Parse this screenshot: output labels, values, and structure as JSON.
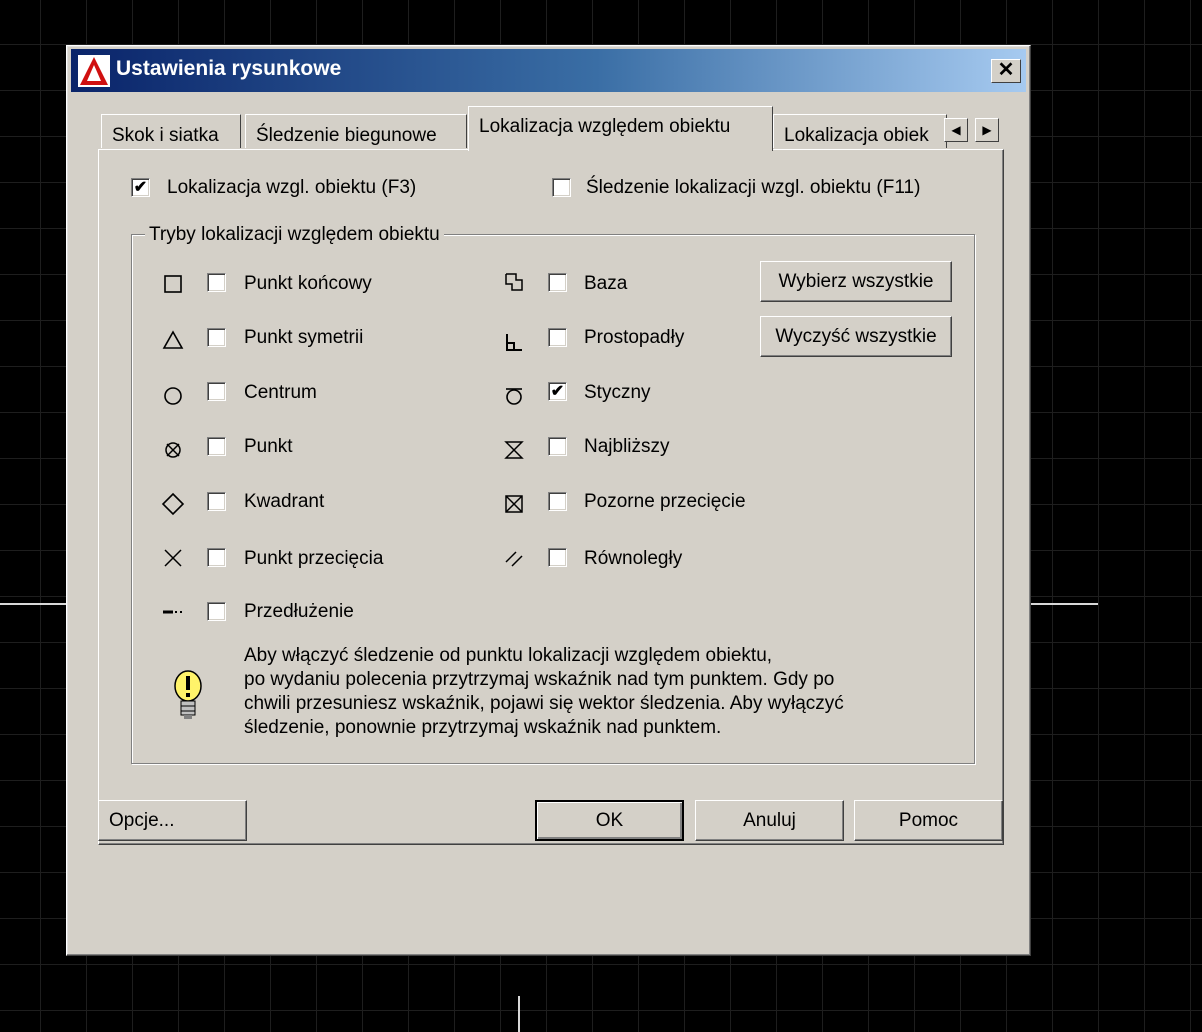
{
  "window": {
    "title": "Ustawienia rysunkowe",
    "close_glyph": "✕"
  },
  "tabs": [
    {
      "label": "Skok i siatka"
    },
    {
      "label": "Śledzenie biegunowe"
    },
    {
      "label": "Lokalizacja względem obiektu",
      "active": true
    },
    {
      "label": "Lokalizacja obiek"
    }
  ],
  "tab_scroll": {
    "left": "◀",
    "right": "▶"
  },
  "top_options": [
    {
      "label": "Lokalizacja wzgl. obiektu (F3)",
      "checked": true
    },
    {
      "label": "Śledzenie lokalizacji wzgl. obiektu (F11)",
      "checked": false
    }
  ],
  "group": {
    "title": "Tryby lokalizacji względem obiektu",
    "left_modes": [
      {
        "label": "Punkt końcowy",
        "icon": "endpoint-icon",
        "checked": false
      },
      {
        "label": "Punkt symetrii",
        "icon": "midpoint-icon",
        "checked": false
      },
      {
        "label": "Centrum",
        "icon": "center-icon",
        "checked": false
      },
      {
        "label": "Punkt",
        "icon": "node-icon",
        "checked": false
      },
      {
        "label": "Kwadrant",
        "icon": "quadrant-icon",
        "checked": false
      },
      {
        "label": "Punkt przecięcia",
        "icon": "intersection-icon",
        "checked": false
      },
      {
        "label": "Przedłużenie",
        "icon": "extension-icon",
        "checked": false
      }
    ],
    "right_modes": [
      {
        "label": "Baza",
        "icon": "insertion-icon",
        "checked": false
      },
      {
        "label": "Prostopadły",
        "icon": "perpendicular-icon",
        "checked": false
      },
      {
        "label": "Styczny",
        "icon": "tangent-icon",
        "checked": true
      },
      {
        "label": "Najbliższy",
        "icon": "nearest-icon",
        "checked": false
      },
      {
        "label": "Pozorne przecięcie",
        "icon": "apparent-intersection-icon",
        "checked": false
      },
      {
        "label": "Równoległy",
        "icon": "parallel-icon",
        "checked": false
      }
    ],
    "select_all_label": "Wybierz wszystkie",
    "clear_all_label": "Wyczyść wszystkie",
    "hint_lines": [
      "Aby włączyć śledzenie od punktu lokalizacji względem obiektu,",
      "po wydaniu polecenia przytrzymaj wskaźnik nad tym punktem. Gdy po",
      "chwili przesuniesz wskaźnik, pojawi się wektor śledzenia. Aby wyłączyć",
      "śledzenie, ponownie przytrzymaj wskaźnik nad punktem."
    ]
  },
  "footer": {
    "options_label": "Opcje...",
    "ok_label": "OK",
    "cancel_label": "Anuluj",
    "help_label": "Pomoc"
  },
  "check_glyph": "✔"
}
